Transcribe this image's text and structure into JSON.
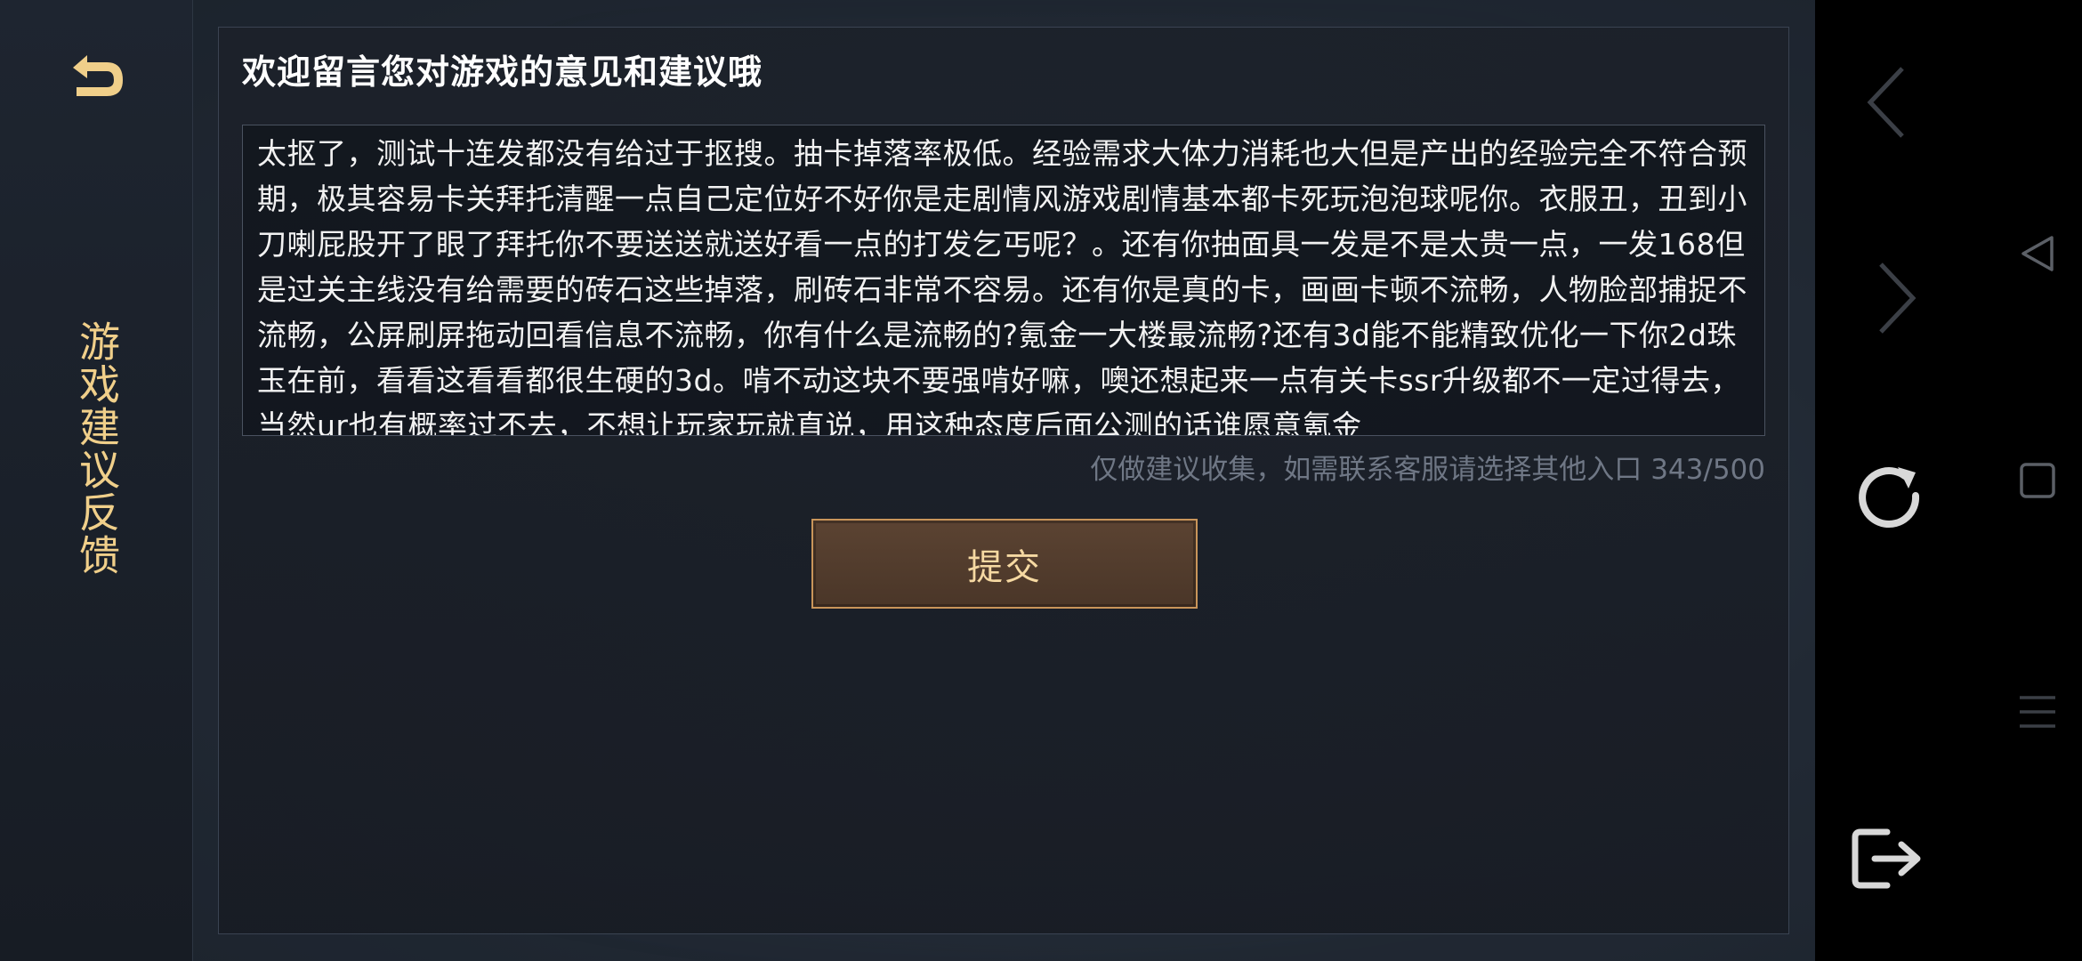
{
  "sidebar": {
    "back_icon": "back-arrow-icon",
    "title": "游戏建议反馈"
  },
  "panel": {
    "title": "欢迎留言您对游戏的意见和建议哦",
    "textarea_value": "太抠了，测试十连发都没有给过于抠搜。抽卡掉落率极低。经验需求大体力消耗也大但是产出的经验完全不符合预期，极其容易卡关拜托清醒一点自己定位好不好你是走剧情风游戏剧情基本都卡死玩泡泡球呢你。衣服丑，丑到小刀喇屁股开了眼了拜托你不要送送就送好看一点的打发乞丐呢？。还有你抽面具一发是不是太贵一点，一发168但是过关主线没有给需要的砖石这些掉落，刷砖石非常不容易。还有你是真的卡，画画卡顿不流畅，人物脸部捕捉不流畅，公屏刷屏拖动回看信息不流畅，你有什么是流畅的?氪金一大楼最流畅?还有3d能不能精致优化一下你2d珠玉在前，看看这看看都很生硬的3d。啃不动这块不要强啃好嘛，噢还想起来一点有关卡ssr升级都不一定过得去，当然ur也有概率过不去，不想让玩家玩就直说，用这种态度后面公测的话谁愿意氪金",
    "hint": "仅做建议收集，如需联系客服请选择其他入口",
    "counter": "343/500",
    "submit_label": "提交"
  },
  "system_bar": {
    "icons": [
      "chevron-left-icon",
      "triangle-back-icon",
      "chevron-right-icon",
      "square-recent-icon",
      "refresh-icon",
      "menu-lines-icon",
      "exit-icon"
    ]
  },
  "colors": {
    "accent_gold": "#f0cf8a",
    "button_border": "#c9955a",
    "button_fill": "#4a3628",
    "hint_gray": "#6f7785"
  }
}
